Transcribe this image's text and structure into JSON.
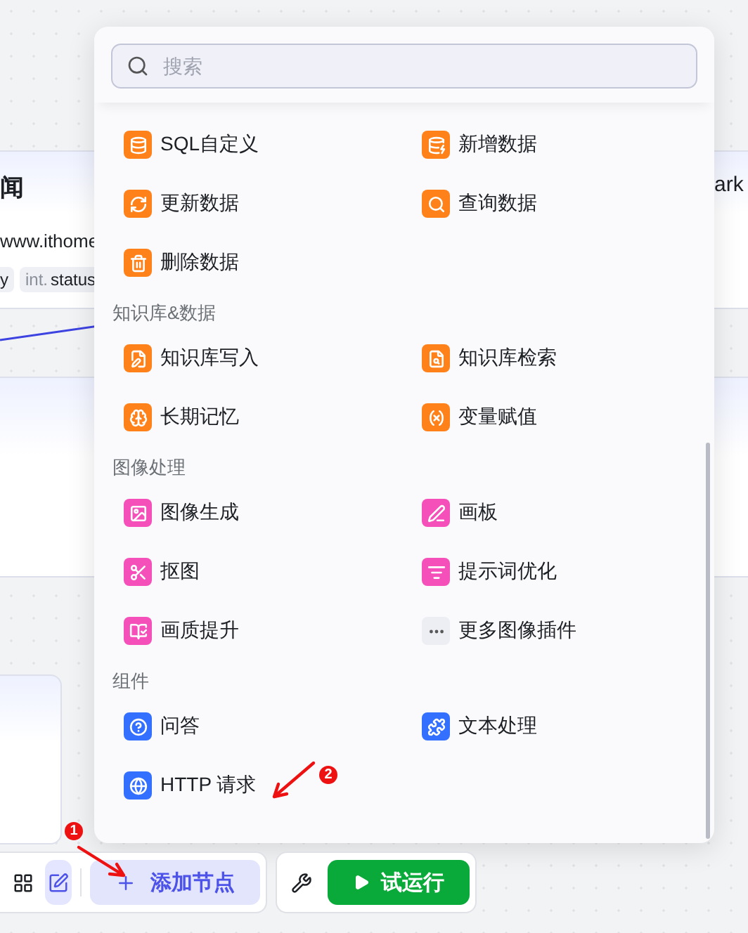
{
  "canvas": {
    "cards": [
      {
        "title": "闻",
        "url": "www.ithome",
        "tags": [
          {
            "name": "y"
          },
          {
            "type": "int.",
            "name": "status"
          }
        ]
      }
    ],
    "right_card_title": "ark"
  },
  "node_menu": {
    "search": {
      "placeholder": "搜索"
    },
    "sections": [
      {
        "items": [
          {
            "label": "SQL自定义",
            "kind": "database",
            "color": "#ff811a"
          },
          {
            "label": "新增数据",
            "kind": "insert",
            "color": "#ff811a"
          },
          {
            "label": "更新数据",
            "kind": "update",
            "color": "#ff811a"
          },
          {
            "label": "查询数据",
            "kind": "query",
            "color": "#ff811a"
          },
          {
            "label": "删除数据",
            "kind": "delete",
            "color": "#ff811a"
          }
        ]
      },
      {
        "title": "知识库&数据",
        "items": [
          {
            "label": "知识库写入",
            "kind": "write",
            "color": "#ff811a"
          },
          {
            "label": "知识库检索",
            "kind": "retrieve",
            "color": "#ff811a"
          },
          {
            "label": "长期记忆",
            "kind": "memory",
            "color": "#ff811a"
          },
          {
            "label": "变量赋值",
            "kind": "variable",
            "color": "#ff811a"
          }
        ]
      },
      {
        "title": "图像处理",
        "items": [
          {
            "label": "图像生成",
            "kind": "image",
            "color": "#f54fb9"
          },
          {
            "label": "画板",
            "kind": "canvas",
            "color": "#f54fb9"
          },
          {
            "label": "抠图",
            "kind": "cutout",
            "color": "#f54fb9"
          },
          {
            "label": "提示词优化",
            "kind": "prompt",
            "color": "#f54fb9"
          },
          {
            "label": "画质提升",
            "kind": "hd",
            "color": "#f54fb9"
          },
          {
            "label": "更多图像插件",
            "kind": "more",
            "color": "#eceef3"
          }
        ]
      },
      {
        "title": "组件",
        "items": [
          {
            "label": "问答",
            "kind": "qa",
            "color": "#3370ff"
          },
          {
            "label": "文本处理",
            "kind": "text",
            "color": "#3370ff"
          },
          {
            "label": "HTTP 请求",
            "kind": "http",
            "color": "#3370ff"
          }
        ]
      }
    ]
  },
  "toolbar": {
    "add_node": "添加节点",
    "test_run": "试运行",
    "annotate_selected": true
  },
  "annotations": [
    {
      "number": "1"
    },
    {
      "number": "2"
    }
  ]
}
